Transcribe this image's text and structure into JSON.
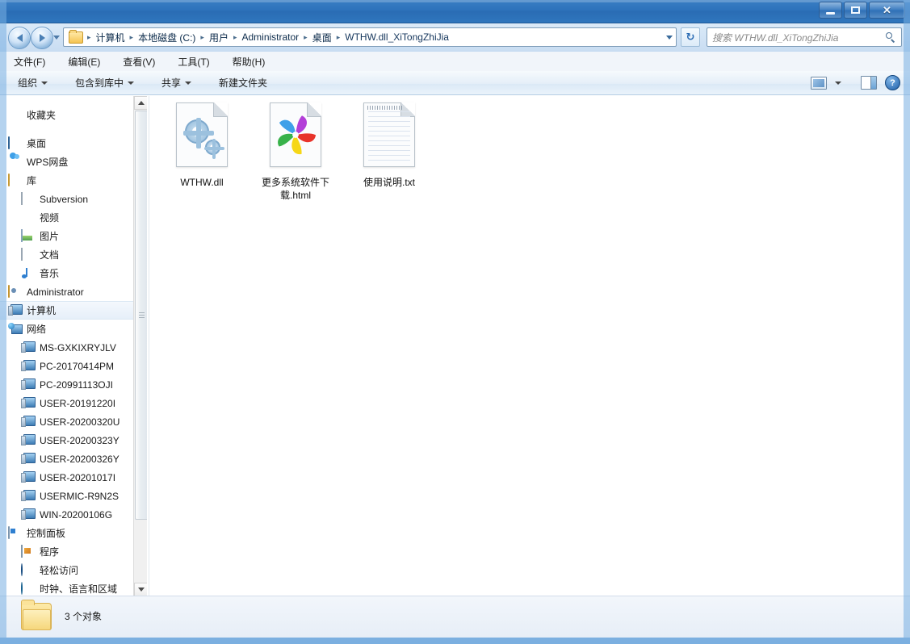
{
  "window": {
    "minimize_label": "–",
    "maximize_label": "□",
    "close_label": "×"
  },
  "address": {
    "back_tooltip": "后退",
    "forward_tooltip": "前进",
    "refresh_label": "↻",
    "crumbs": [
      "计算机",
      "本地磁盘 (C:)",
      "用户",
      "Administrator",
      "桌面",
      "WTHW.dll_XiTongZhiJia"
    ],
    "separator": "▸"
  },
  "search": {
    "placeholder": "搜索 WTHW.dll_XiTongZhiJia"
  },
  "menubar": {
    "items": [
      {
        "label": "文件(F)"
      },
      {
        "label": "编辑(E)"
      },
      {
        "label": "查看(V)"
      },
      {
        "label": "工具(T)"
      },
      {
        "label": "帮助(H)"
      }
    ]
  },
  "commandbar": {
    "organize": "组织",
    "include_in_library": "包含到库中",
    "share": "共享",
    "new_folder": "新建文件夹",
    "help_label": "?"
  },
  "sidebar": {
    "items": [
      {
        "label": "收藏夹",
        "icon": "star-icon",
        "indent": 0,
        "selected": false
      },
      {
        "label": "桌面",
        "icon": "desktop-icon",
        "indent": 0,
        "selected": false
      },
      {
        "label": "WPS网盘",
        "icon": "cloud-icon",
        "indent": 1,
        "selected": false
      },
      {
        "label": "库",
        "icon": "library-icon",
        "indent": 1,
        "selected": false
      },
      {
        "label": "Subversion",
        "icon": "subversion-icon",
        "indent": 2,
        "selected": false
      },
      {
        "label": "视频",
        "icon": "video-icon",
        "indent": 2,
        "selected": false
      },
      {
        "label": "图片",
        "icon": "pictures-icon",
        "indent": 2,
        "selected": false
      },
      {
        "label": "文档",
        "icon": "documents-icon",
        "indent": 2,
        "selected": false
      },
      {
        "label": "音乐",
        "icon": "music-icon",
        "indent": 2,
        "selected": false
      },
      {
        "label": "Administrator",
        "icon": "user-folder-icon",
        "indent": 1,
        "selected": false
      },
      {
        "label": "计算机",
        "icon": "computer-icon",
        "indent": 1,
        "selected": true
      },
      {
        "label": "网络",
        "icon": "network-icon",
        "indent": 1,
        "selected": false
      },
      {
        "label": "MS-GXKIXRYJLV",
        "icon": "network-computer-icon",
        "indent": 2,
        "selected": false
      },
      {
        "label": "PC-20170414PM",
        "icon": "network-computer-icon",
        "indent": 2,
        "selected": false
      },
      {
        "label": "PC-20991113OJI",
        "icon": "network-computer-icon",
        "indent": 2,
        "selected": false
      },
      {
        "label": "USER-20191220I",
        "icon": "network-computer-icon",
        "indent": 2,
        "selected": false
      },
      {
        "label": "USER-20200320U",
        "icon": "network-computer-icon",
        "indent": 2,
        "selected": false
      },
      {
        "label": "USER-20200323Y",
        "icon": "network-computer-icon",
        "indent": 2,
        "selected": false
      },
      {
        "label": "USER-20200326Y",
        "icon": "network-computer-icon",
        "indent": 2,
        "selected": false
      },
      {
        "label": "USER-20201017I",
        "icon": "network-computer-icon",
        "indent": 2,
        "selected": false
      },
      {
        "label": "USERMIC-R9N2S",
        "icon": "network-computer-icon",
        "indent": 2,
        "selected": false
      },
      {
        "label": "WIN-20200106G",
        "icon": "network-computer-icon",
        "indent": 2,
        "selected": false
      },
      {
        "label": "控制面板",
        "icon": "control-panel-icon",
        "indent": 1,
        "selected": false
      },
      {
        "label": "程序",
        "icon": "programs-icon",
        "indent": 2,
        "selected": false
      },
      {
        "label": "轻松访问",
        "icon": "ease-of-access-icon",
        "indent": 2,
        "selected": false
      },
      {
        "label": "时钟、语言和区域",
        "icon": "clock-region-icon",
        "indent": 2,
        "selected": false
      }
    ]
  },
  "files": [
    {
      "name": "WTHW.dll",
      "icon": "dll-gear-icon"
    },
    {
      "name": "更多系统软件下载.html",
      "icon": "html-pinwheel-icon"
    },
    {
      "name": "使用说明.txt",
      "icon": "text-file-icon"
    }
  ],
  "status": {
    "item_count": "3 个对象"
  },
  "colors": {
    "titlebar": "#2d72bb",
    "accent": "#1d5796",
    "content_bg": "#ffffff",
    "toolbar_bg": "#e4eef8"
  }
}
